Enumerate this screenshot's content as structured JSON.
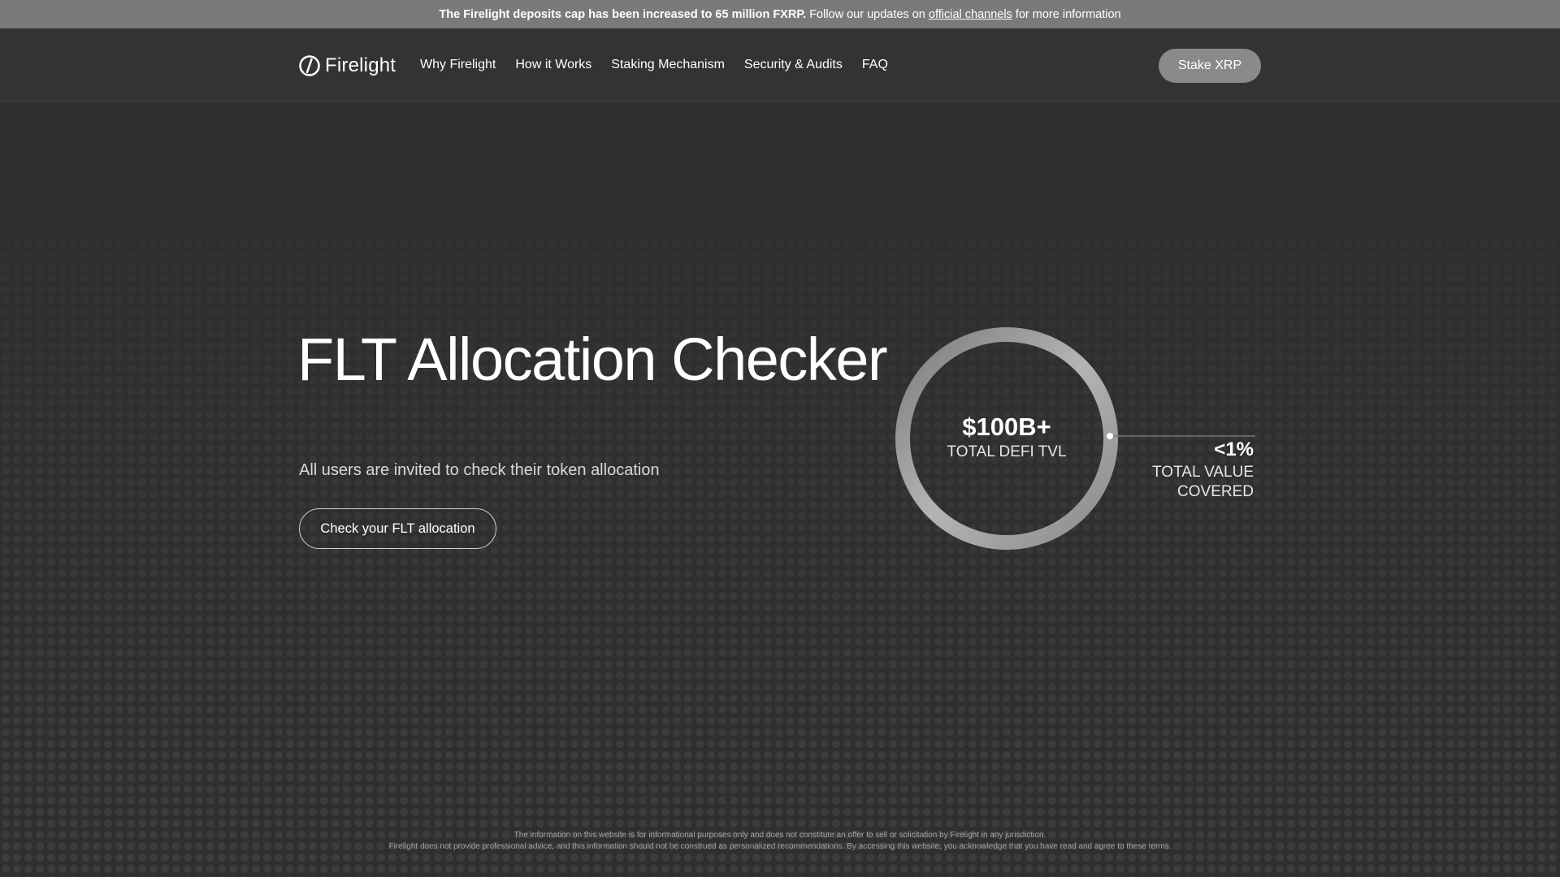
{
  "banner": {
    "bold_text": "The Firelight deposits cap has been increased to 65 million FXRP.",
    "text_before_link": "Follow our updates on",
    "link_text": "official channels",
    "text_after_link": "for more information"
  },
  "header": {
    "logo_text": "Firelight",
    "nav": [
      {
        "label": "Why Firelight"
      },
      {
        "label": "How it Works"
      },
      {
        "label": "Staking Mechanism"
      },
      {
        "label": "Security & Audits"
      },
      {
        "label": "FAQ"
      }
    ],
    "cta_label": "Stake XRP"
  },
  "hero": {
    "title": "FLT Allocation Checker",
    "subtitle": "All users are invited to check their token allocation",
    "cta_label": "Check your FLT allocation"
  },
  "stats": {
    "ring_value": "$100B+",
    "ring_label": "TOTAL DEFI TVL",
    "side_value": "<1%",
    "side_label_line1": "TOTAL VALUE",
    "side_label_line2": "COVERED"
  },
  "footer": {
    "disclaimer_line1": "The information on this website is for informational purposes only and does not constitute an offer to sell or solicitation by Firelight in any jurisdiction.",
    "disclaimer_line2": "Firelight does not provide professional advice, and this information should not be construed as personalized recommendations. By accessing this website, you acknowledge that you have read and agree to these terms."
  },
  "colors": {
    "background": "#2f2f2f",
    "banner": "#7a7a7a",
    "stake_button": "#8a8a8a",
    "text": "#ffffff"
  }
}
